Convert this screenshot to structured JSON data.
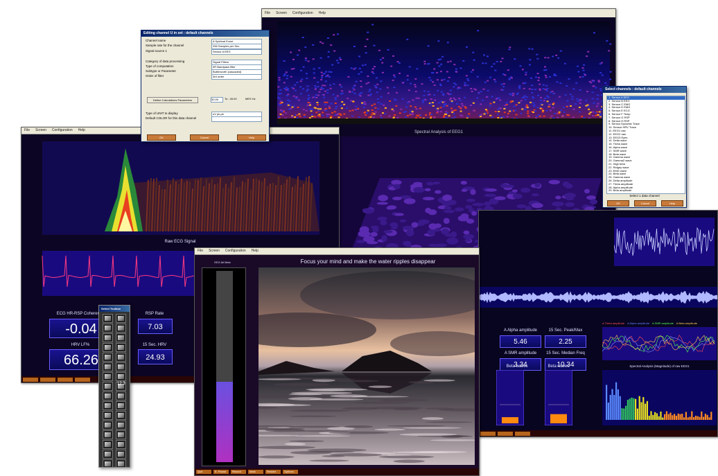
{
  "spectrogram_window": {
    "menu": [
      "File",
      "Screen",
      "Configuration",
      "Help"
    ],
    "title": "Spectral Analysis of EEG1"
  },
  "left_window": {
    "menu": [
      "File",
      "Screen",
      "Configuration",
      "Help"
    ],
    "signal_title": "Raw ECG Signal",
    "meters": [
      {
        "label": "ECG HR-RSP Coherence",
        "value": "-0.04"
      },
      {
        "label": "RSP Rate",
        "value": "7.03"
      },
      {
        "label": "HRV LF%",
        "value": "66.26"
      },
      {
        "label": "15 Sec. HRV",
        "value": "24.93"
      }
    ]
  },
  "channel_dialog": {
    "title": "Editing channel U in set : default channels",
    "fields": [
      {
        "label": "Channel name",
        "value": "A Spiritual Event"
      },
      {
        "label": "Sample rate for the channel",
        "value": "256 Samples per Sec."
      },
      {
        "label": "Signal source 1",
        "value": "Sensor A EEG"
      },
      {
        "label": "Category of data processing",
        "value": "Signal Filters"
      },
      {
        "label": "Type of computation",
        "value": "IIR Bandpass filter"
      },
      {
        "label": "Subtype or Parameter",
        "value": "Butterworth (cascaded)"
      },
      {
        "label": "Order of filter",
        "value": "3rd order"
      },
      {
        "label": "Type of UNIT to display",
        "value": "uV pk-pk"
      },
      {
        "label": "Default COLOR for this data channel",
        "value": ""
      }
    ],
    "freq_low": "30.00",
    "freq_to": "To : 45.00",
    "freq_unit": "MES Hz",
    "define_button": "Define Calculations Parameters",
    "buttons": [
      "OK",
      "Cancel",
      "Help"
    ]
  },
  "select_dialog": {
    "title": "Select channels : default channels",
    "items": [
      "1. Sensor A EEG",
      "2. Sensor B EEG",
      "3. Sensor C EMG",
      "4. Sensor D EMG",
      "5. Sensor E ECG",
      "6. Sensor F Temp",
      "7. Sensor G RSP",
      "8. Sensor H RSP",
      "9. Sensor Dynamic Trace",
      "10. Sensor HRV Trace",
      "11. EEG1 raw",
      "12. EEG2 raw",
      "13. EEG3 Eyes",
      "14. Delta wave",
      "15. Theta wave",
      "16. Alpha wave",
      "17. SMR wave",
      "18. Beta wave",
      "19. Gamma wave",
      "20. Gamma2 wave",
      "21. High beta",
      "22. Ridgey wave",
      "23. EMG wave",
      "24. Beta wave",
      "25. Gamma wave",
      "26. Delta amplitude",
      "27. Theta amplitude",
      "28. Alpha amplitude",
      "29. Beta amplitude"
    ],
    "footer": "Select 1 data channel",
    "buttons": [
      "OK",
      "Cancel",
      "Help"
    ]
  },
  "center_window": {
    "menu": [
      "File",
      "Screen",
      "Configuration",
      "Help"
    ],
    "title": "Focus your mind and make the water ripples disappear",
    "bar_label": "EEG Alt Beta",
    "bar_value_fraction": 0.42,
    "status": [
      "Quit",
      "E. Pause",
      "Record",
      "Mark",
      "Restart",
      "Options"
    ]
  },
  "right_window": {
    "meters": [
      {
        "label": "A Alpha amplitude",
        "value": "5.46"
      },
      {
        "label": "15 Sec. Peak/Max",
        "value": "2.25"
      },
      {
        "label": "A SMR amplitude",
        "value": "3.34"
      },
      {
        "label": "15 Sec. Median Freq",
        "value": "10.34"
      }
    ],
    "legend": [
      "A Theta amplitude",
      "A Alpha amplitude",
      "A SMR amplitude",
      "A Beta amplitude"
    ],
    "bar_labels": [
      "Beta waves",
      "Beta waves"
    ],
    "spectral_title": "Spectral Analysis (Magnitude) of raw EEG1",
    "bar_fractions": [
      0.12,
      0.18
    ]
  },
  "toolbox": {
    "title": "Select Toolbox",
    "number_label": "12.3"
  },
  "colors": {
    "dark_bg": "#0c0624",
    "accent": "#6a5cff",
    "status_btn": "#b5651d"
  }
}
